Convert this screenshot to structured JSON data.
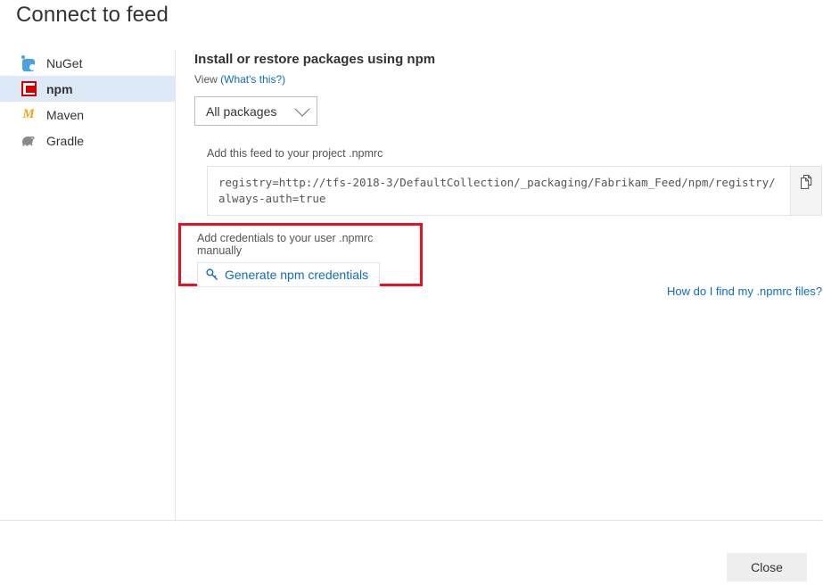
{
  "dialog": {
    "title": "Connect to feed",
    "close_label": "Close"
  },
  "sidebar": {
    "items": [
      {
        "label": "NuGet",
        "icon": "nuget-icon",
        "selected": false
      },
      {
        "label": "npm",
        "icon": "npm-icon",
        "selected": true
      },
      {
        "label": "Maven",
        "icon": "maven-icon",
        "selected": false
      },
      {
        "label": "Gradle",
        "icon": "gradle-icon",
        "selected": false
      }
    ]
  },
  "main": {
    "heading": "Install or restore packages using npm",
    "view_prefix": "View ",
    "view_link": "(What's this?)",
    "dropdown": {
      "value": "All packages",
      "chevron_icon": "chevron-down-icon"
    },
    "feed_label": "Add this feed to your project .npmrc",
    "code_line_1": "registry=http://tfs-2018-3/DefaultCollection/_packaging/Fabrikam_Feed/npm/registry/",
    "code_line_2": "always-auth=true",
    "copy_icon": "copy-icon",
    "credentials": {
      "label": "Add credentials to your user .npmrc manually",
      "button_label": "Generate npm credentials",
      "button_icon": "key-icon",
      "highlight_color": "#e81123"
    },
    "help_link": "How do I find my .npmrc files?"
  },
  "colors": {
    "accent_link": "#0f6cbd",
    "selection_bg": "#dde9f7",
    "npm_red": "#d40000",
    "maven_orange": "#f0a01e",
    "highlight_red": "#e81123"
  }
}
